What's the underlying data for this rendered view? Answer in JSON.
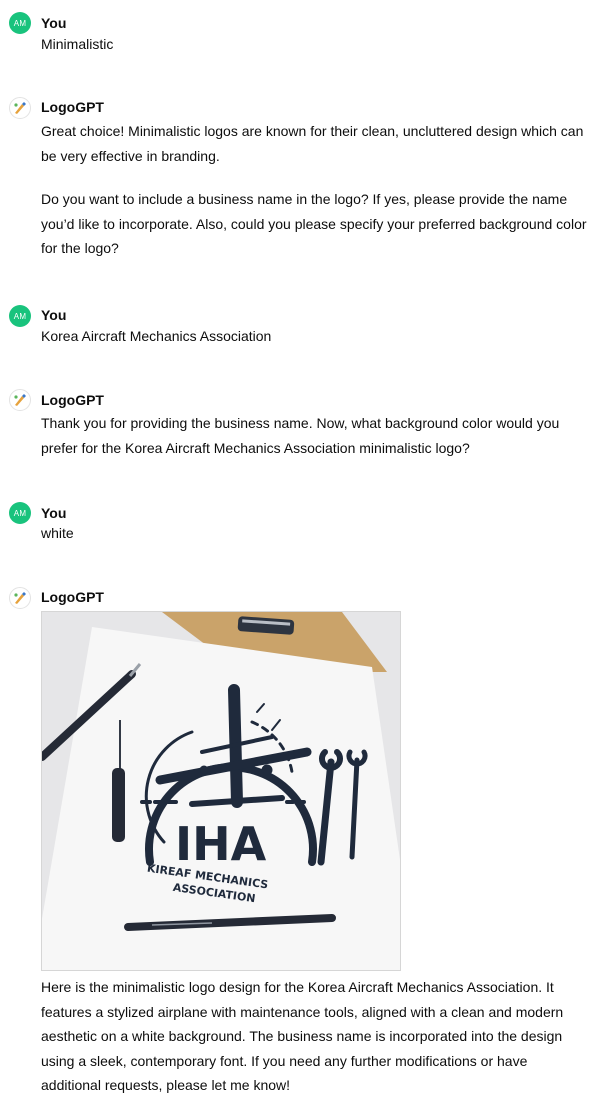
{
  "messages": [
    {
      "author": "You",
      "avatar": "AM",
      "text": "Minimalistic"
    },
    {
      "author": "LogoGPT",
      "paragraphs": [
        "Great choice! Minimalistic logos are known for their clean, uncluttered design which can be very effective in branding.",
        "Do you want to include a business name in the logo? If yes, please provide the name you’d like to incorporate. Also, could you please specify your preferred background color for the logo?"
      ]
    },
    {
      "author": "You",
      "avatar": "AM",
      "text": "Korea Aircraft Mechanics Association"
    },
    {
      "author": "LogoGPT",
      "text": "Thank you for providing the business name. Now, what background color would you prefer for the Korea Aircraft Mechanics Association minimalistic logo?"
    },
    {
      "author": "You",
      "avatar": "AM",
      "text": "white"
    },
    {
      "author": "LogoGPT",
      "image": {
        "logo_letters": "IHA",
        "arc_text_line1": "KIREAF MECHANICS",
        "arc_text_line2": "ASSOCIATION"
      },
      "text": "Here is the minimalistic logo design for the Korea Aircraft Mechanics Association. It features a stylized airplane with maintenance tools, aligned with a clean and modern aesthetic on a white background. The business name is incorporated into the design using a sleek, contemporary font. If you need any further modifications or have additional requests, please let me know!"
    }
  ],
  "colors": {
    "user_avatar": "#19c37d",
    "logo_ink": "#1f2a3c",
    "folder": "#caa36a"
  }
}
